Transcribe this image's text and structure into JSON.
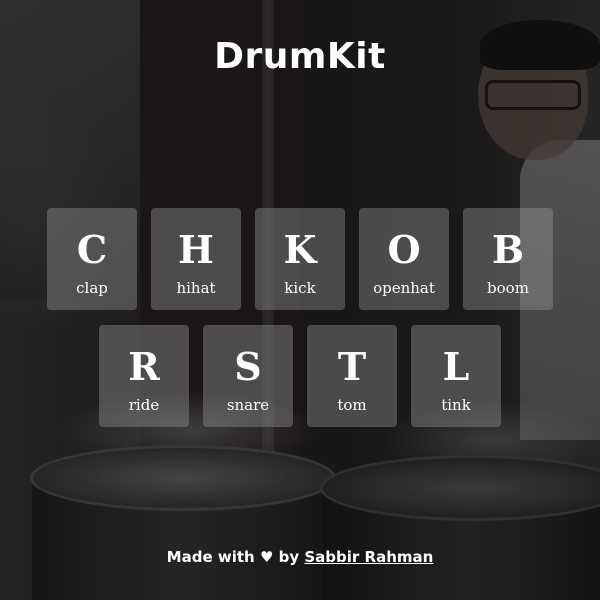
{
  "page": {
    "title": "DrumKit"
  },
  "keys": {
    "row1": [
      {
        "letter": "C",
        "sound": "clap"
      },
      {
        "letter": "H",
        "sound": "hihat"
      },
      {
        "letter": "K",
        "sound": "kick"
      },
      {
        "letter": "O",
        "sound": "openhat"
      },
      {
        "letter": "B",
        "sound": "boom"
      }
    ],
    "row2": [
      {
        "letter": "R",
        "sound": "ride"
      },
      {
        "letter": "S",
        "sound": "snare"
      },
      {
        "letter": "T",
        "sound": "tom"
      },
      {
        "letter": "L",
        "sound": "tink"
      }
    ]
  },
  "footer": {
    "prefix": "Made with",
    "heart": "♥",
    "by": "by",
    "author": "Sabbir Rahman"
  },
  "colors": {
    "text": "#ffffff",
    "key_background": "rgba(160,160,160,0.38)"
  }
}
